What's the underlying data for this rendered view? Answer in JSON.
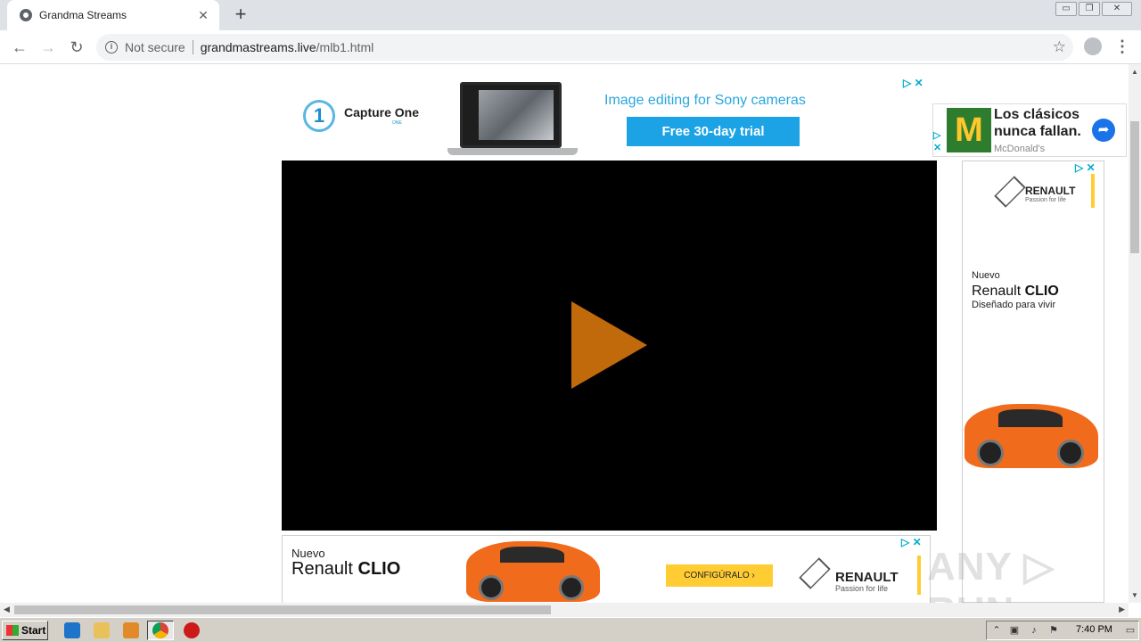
{
  "browser": {
    "tab_title": "Grandma Streams",
    "tab_close": "✕",
    "new_tab": "+",
    "window_buttons": [
      "▭",
      "❐",
      "✕"
    ],
    "back": "←",
    "forward": "→",
    "reload": "↻",
    "security_label": "Not secure",
    "url_host": "grandmastreams.live",
    "url_path": "/mlb1.html",
    "star": "☆",
    "menu": "⋮"
  },
  "ads": {
    "top": {
      "brand": "Capture One",
      "brand_mark": "1",
      "brand_sub": "ONE",
      "headline": "Image editing for Sony cameras",
      "cta": "Free 30-day trial",
      "adchoice": "▷ ✕"
    },
    "mcdonalds": {
      "logo": "M",
      "headline": "Los clásicos nunca fallan.",
      "brand": "McDonald's",
      "go": "➦",
      "adchoice": "▷ ✕"
    },
    "side": {
      "brand": "RENAULT",
      "tagline": "Passion for life",
      "nuevo": "Nuevo",
      "model_prefix": "Renault ",
      "model_name": "CLIO",
      "claim": "Diseñado para vivir",
      "adchoice": "▷ ✕"
    },
    "bottom": {
      "nuevo": "Nuevo",
      "model_prefix": "Renault ",
      "model_name": "CLIO",
      "cta": "CONFIGÚRALO ›",
      "brand": "RENAULT",
      "tagline": "Passion for life",
      "adchoice": "▷ ✕"
    }
  },
  "player": {
    "play_icon": "play-icon"
  },
  "watermark": "ANY ▷ RUN",
  "taskbar": {
    "start_label": "Start",
    "clock": "7:40 PM"
  }
}
